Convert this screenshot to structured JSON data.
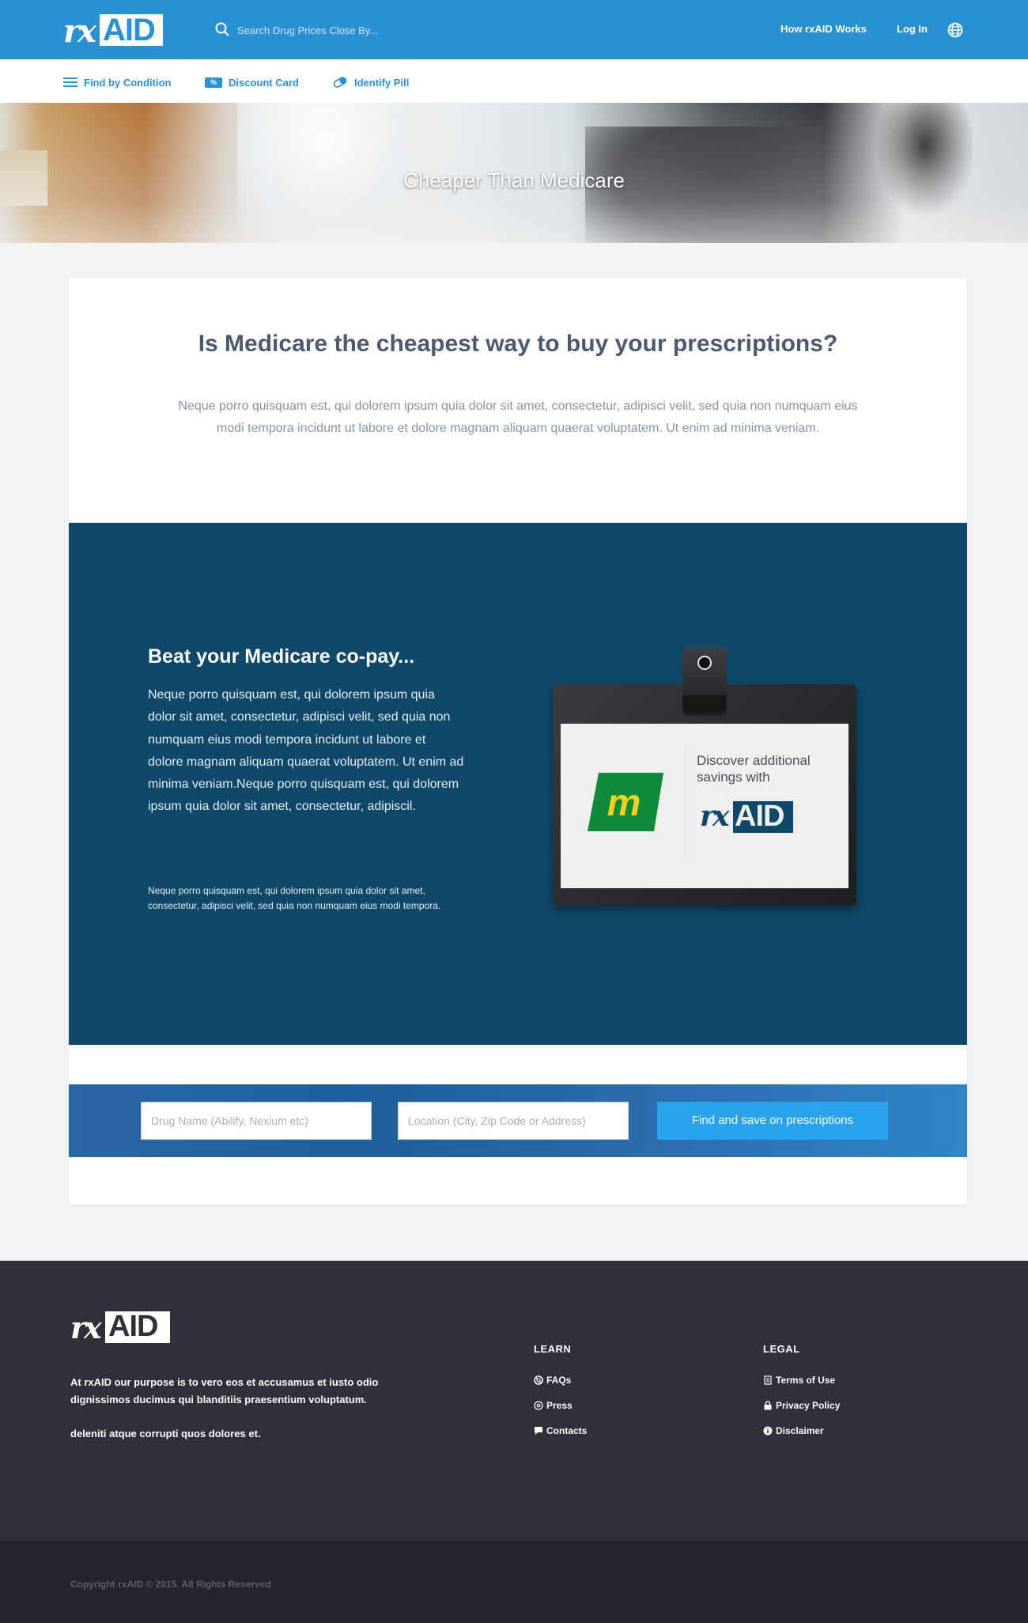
{
  "header": {
    "logo_rx": "rx",
    "logo_aid": "AID",
    "search_placeholder": "Search Drug Prices Close By...",
    "nav": [
      "How rxAID Works",
      "Log In"
    ],
    "globe_icon": "globe-icon"
  },
  "subnav": {
    "items": [
      {
        "label": "Find by Condition",
        "icon": "menu-icon"
      },
      {
        "label": "Discount Card",
        "icon": "percent-badge-icon",
        "badge": "%"
      },
      {
        "label": "Identify Pill",
        "icon": "pill-icon"
      }
    ]
  },
  "hero": {
    "title": "Cheaper Than Medicare"
  },
  "intro": {
    "title": "Is Medicare the cheapest way to buy your prescriptions?",
    "body": "Neque porro quisquam est, qui dolorem ipsum quia dolor sit amet, consectetur, adipisci velit, sed quia non numquam eius modi tempora incidunt ut labore et dolore magnam aliquam quaerat voluptatem. Ut enim ad minima veniam."
  },
  "promo": {
    "heading": "Beat your Medicare co-pay...",
    "body": "Neque porro quisquam est, qui dolorem ipsum quia dolor sit amet, consectetur, adipisci velit, sed quia non numquam eius modi tempora incidunt ut labore et dolore magnam aliquam quaerat voluptatem. Ut enim ad minima veniam.Neque porro quisquam est, qui dolorem ipsum quia dolor sit amet, consectetur, adipiscil.",
    "small": "Neque porro quisquam est, qui dolorem ipsum quia dolor sit amet, consectetur, adipisci velit, sed quia non numquam eius modi tempora.",
    "badge_text": "Discover additional savings with",
    "m_logo_letter": "m",
    "colors": {
      "background": "#0f4868",
      "m_green": "#0d8a3a",
      "m_yellow": "#f2d11b"
    }
  },
  "search_band": {
    "drug_placeholder": "Drug Name (Abilify, Nexium etc)",
    "location_placeholder": "Location (City, Zip Code or Address)",
    "button": "Find and save on prescriptions"
  },
  "footer": {
    "about": "At rxAID our purpose is to vero eos et accusamus et iusto odio dignissimos ducimus qui blanditiis praesentium voluptatum.",
    "about2": "deleniti atque corrupti quos dolores et.",
    "learn": {
      "heading": "LEARN",
      "links": [
        {
          "label": "FAQs",
          "icon": "lifebuoy-icon"
        },
        {
          "label": "Press",
          "icon": "at-icon"
        },
        {
          "label": "Contacts",
          "icon": "chat-icon"
        }
      ]
    },
    "legal": {
      "heading": "LEGAL",
      "links": [
        {
          "label": "Terms of Use",
          "icon": "document-icon"
        },
        {
          "label": "Privacy Policy",
          "icon": "lock-icon"
        },
        {
          "label": "Disclaimer",
          "icon": "info-icon"
        }
      ]
    },
    "copyright": "Copyright rxAID © 2015. All Rights Reserved"
  },
  "theme": {
    "primary": "#2a90d4",
    "button": "#29a3ee",
    "footer": "#2f3039"
  }
}
